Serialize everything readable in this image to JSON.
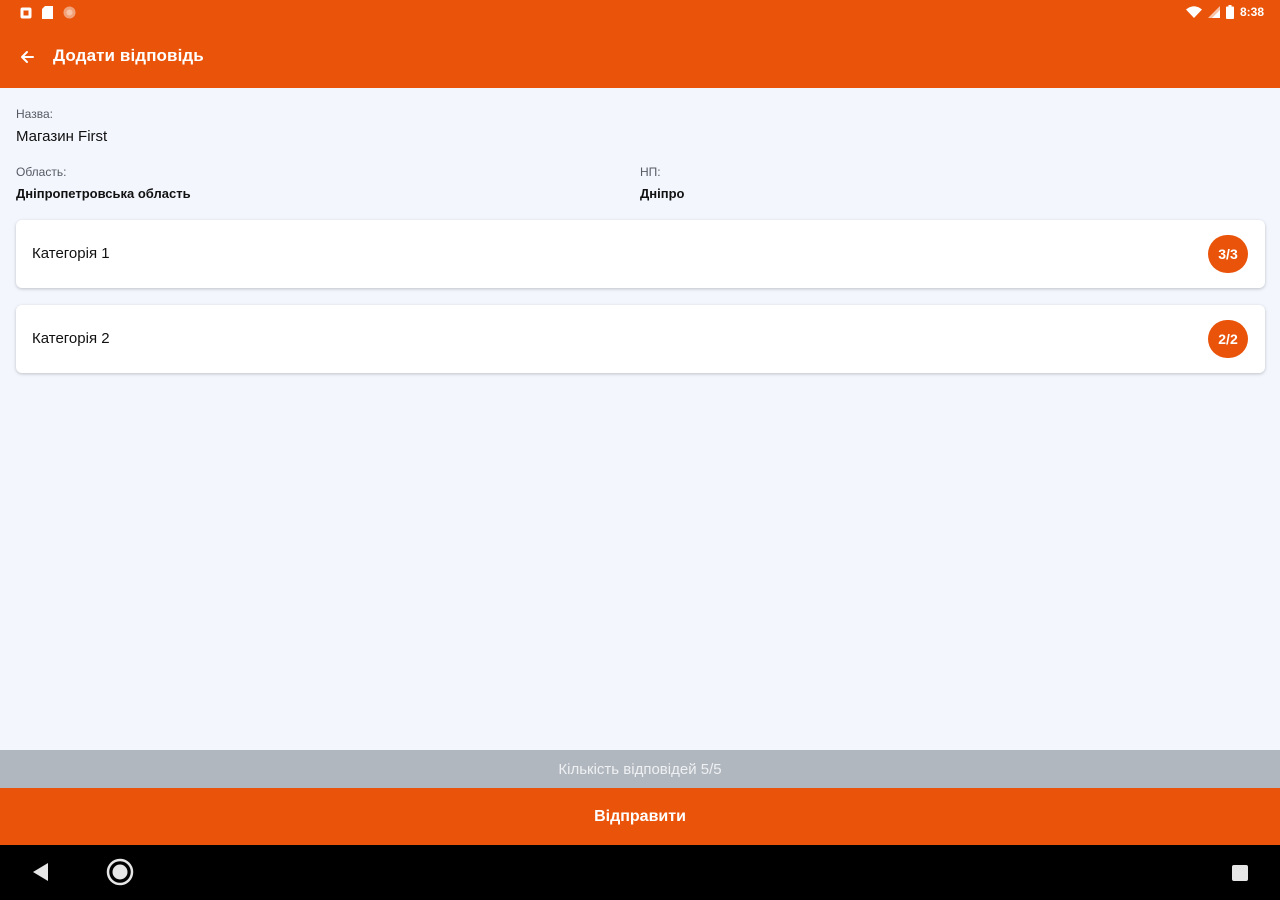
{
  "status_bar": {
    "time": "8:38",
    "icons": [
      "notification-icon",
      "sd-card-icon",
      "sync-icon",
      "wifi-icon",
      "signal-icon",
      "battery-icon"
    ]
  },
  "toolbar": {
    "back_icon": "arrow-back-icon",
    "title": "Додати відповідь"
  },
  "store": {
    "name_label": "Назва:",
    "name_value": "Магазин First",
    "region_label": "Область:",
    "region_value": "Дніпропетровська область",
    "locality_label": "НП:",
    "locality_value": "Дніпро"
  },
  "categories": [
    {
      "label": "Категорія 1",
      "badge": "3/3"
    },
    {
      "label": "Категорія 2",
      "badge": "2/2"
    }
  ],
  "footer": {
    "count_text": "Кількість відповідей 5/5",
    "submit_label": "Відправити"
  },
  "nav": {
    "icons": [
      "nav-back-icon",
      "nav-home-icon",
      "nav-recents-icon"
    ]
  },
  "colors": {
    "accent": "#e9540a",
    "background": "#f3f6fd",
    "count_bar": "#b1b7be",
    "nav_bar": "#000000"
  }
}
